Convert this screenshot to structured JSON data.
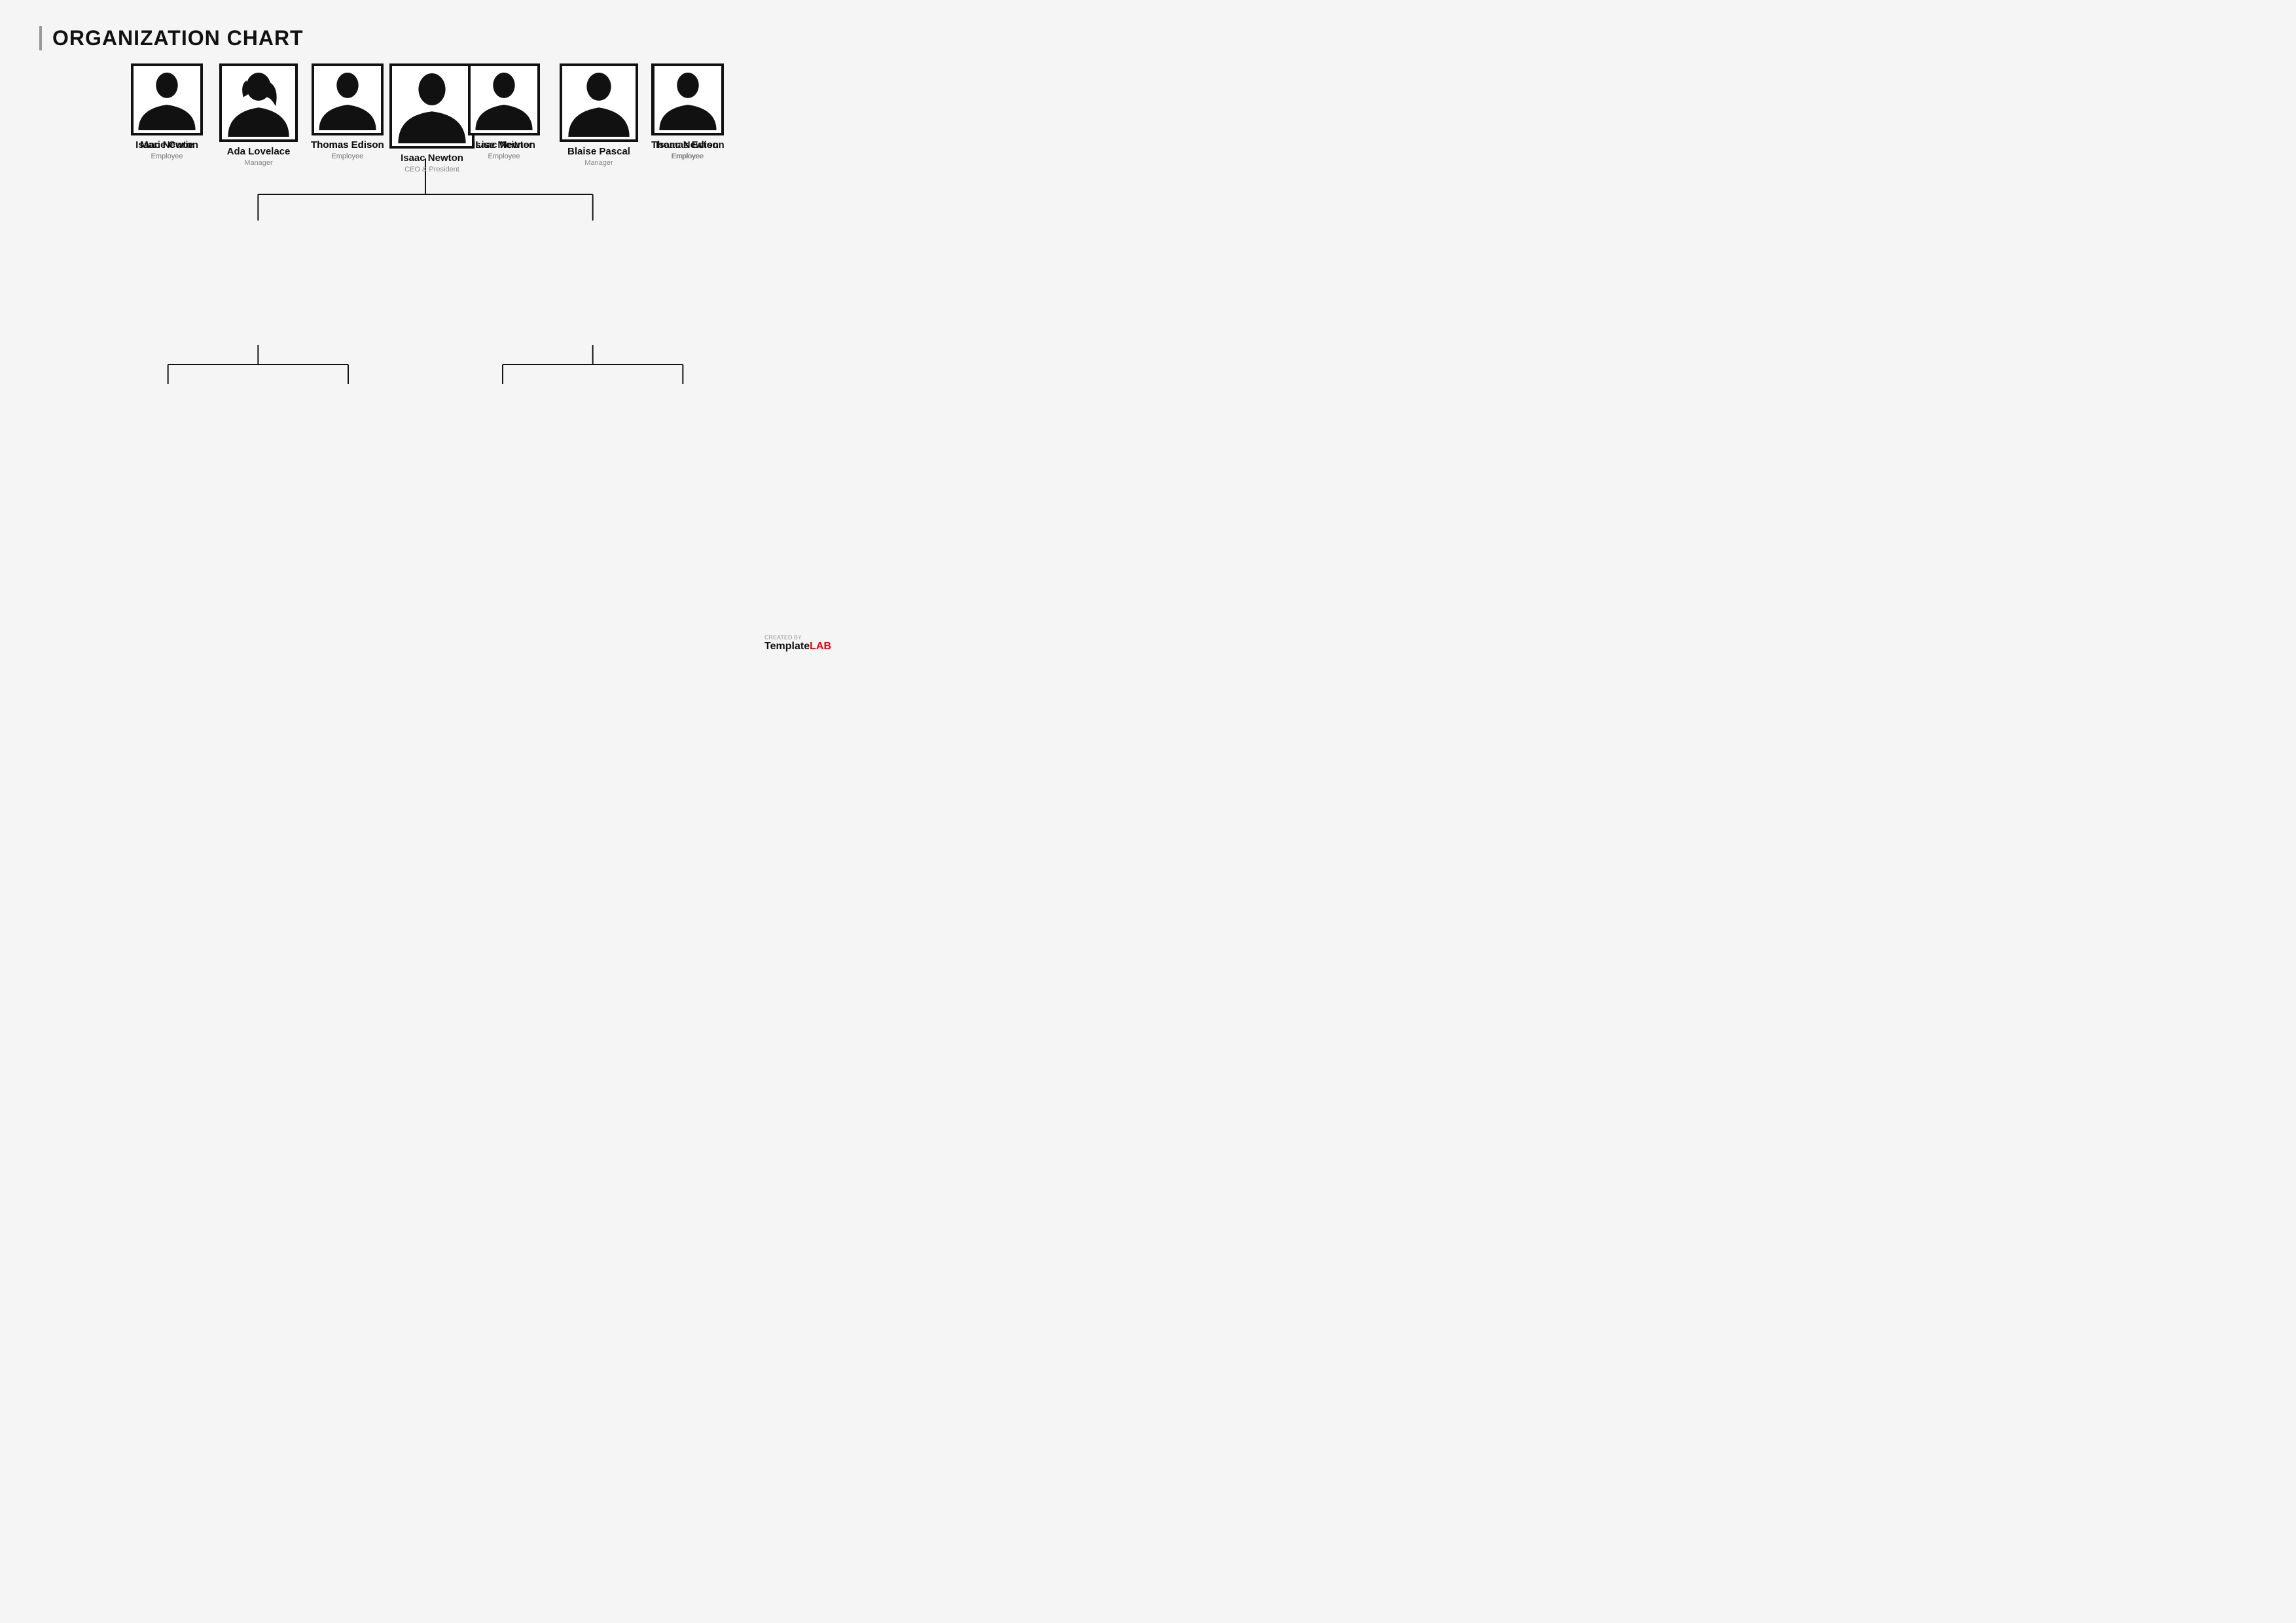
{
  "title": "ORGANIZATION CHART",
  "nodes": {
    "ceo": {
      "name": "Isaac Newton",
      "role": "CEO & President"
    },
    "mgr1": {
      "name": "Ada Lovelace",
      "role": "Manager"
    },
    "mgr2": {
      "name": "Blaise Pascal",
      "role": "Manager"
    },
    "emp1": {
      "name": "Marie Curie",
      "role": "Employee"
    },
    "emp2": {
      "name": "Thomas Edison",
      "role": "Employee"
    },
    "emp3": {
      "name": "Lise Meitner",
      "role": "Employee"
    },
    "emp4": {
      "name": "Isaac Newton",
      "role": "Employee"
    },
    "emp5": {
      "name": "Isaac Newton",
      "role": "Employee"
    },
    "emp6": {
      "name": "Thomas Edison",
      "role": "Employee"
    },
    "emp7": {
      "name": "Isaac Newton",
      "role": "Employee"
    },
    "emp8": {
      "name": "Thomas Edison",
      "role": "Employee"
    }
  },
  "logo": {
    "created_by": "CREATED BY",
    "template": "Template",
    "lab": "LAB"
  }
}
